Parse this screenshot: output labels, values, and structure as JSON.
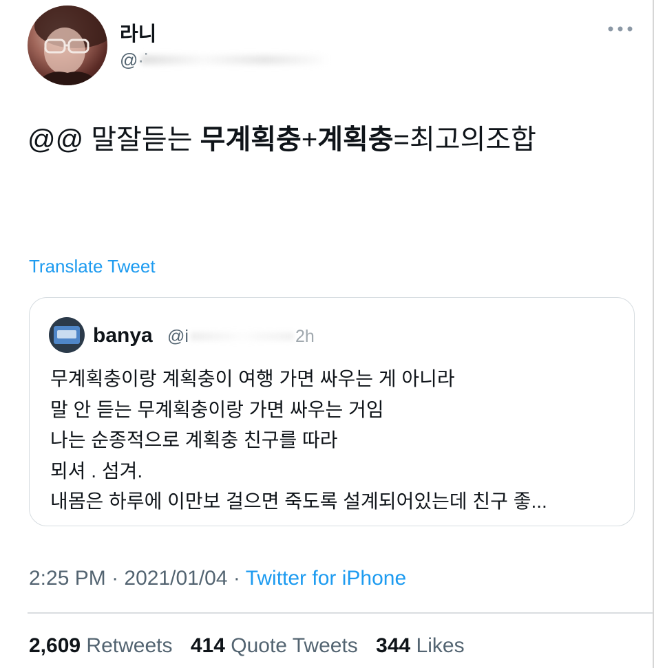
{
  "author": {
    "display_name": "라니",
    "handle": "@·˙"
  },
  "tweet": {
    "text_segments": [
      {
        "text": "@@ 말잘듣는 ",
        "bold": false
      },
      {
        "text": "무계획충",
        "bold": true
      },
      {
        "text": "+",
        "bold": false
      },
      {
        "text": "계획충",
        "bold": true
      },
      {
        "text": "=최고의조합",
        "bold": false
      }
    ],
    "translate_label": "Translate Tweet"
  },
  "quoted_tweet": {
    "display_name": "banya",
    "handle": "@i",
    "time": "2h",
    "lines": [
      "무계획충이랑 계획충이 여행 가면 싸우는 게 아니라",
      "말 안 듣는 무계획충이랑 가면 싸우는 거임",
      "나는 순종적으로 계획충 친구를 따라",
      "뫼셔 . 섬겨.",
      "내몸은 하루에 이만보 걸으면 죽도록 설계되어있는데 친구 좋..."
    ]
  },
  "meta": {
    "time": "2:25 PM",
    "separator": " · ",
    "date": "2021/01/04",
    "source": "Twitter for iPhone"
  },
  "stats": {
    "retweets": {
      "count": "2,609",
      "label": "Retweets"
    },
    "quote_tweets": {
      "count": "414",
      "label": "Quote Tweets"
    },
    "likes": {
      "count": "344",
      "label": "Likes"
    }
  },
  "colors": {
    "link": "#1d9bf0",
    "secondary_text": "#536471",
    "primary_text": "#0f1419"
  },
  "icons": {
    "more": "more-dots-icon",
    "author_avatar": "avatar",
    "quote_avatar": "avatar"
  }
}
